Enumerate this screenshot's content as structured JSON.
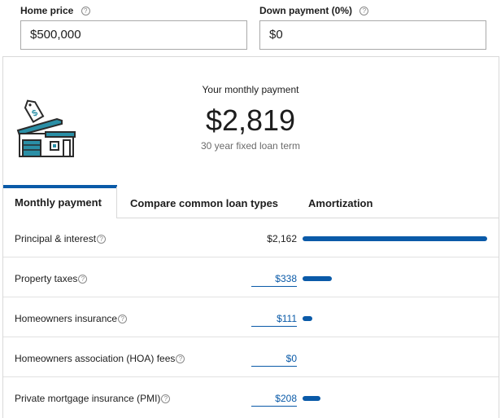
{
  "inputs": {
    "home_price": {
      "label": "Home price",
      "value": "$500,000"
    },
    "down_payment": {
      "label": "Down payment (0%)",
      "value": "$0"
    }
  },
  "help_glyph": "?",
  "summary": {
    "caption": "Your monthly payment",
    "amount": "$2,819",
    "term": "30 year fixed loan term"
  },
  "tabs": [
    {
      "label": "Monthly payment",
      "active": true
    },
    {
      "label": "Compare common loan types",
      "active": false
    },
    {
      "label": "Amortization",
      "active": false
    }
  ],
  "breakdown": [
    {
      "label": "Principal & interest",
      "amount": "$2,162",
      "editable": false,
      "fraction": 0.767
    },
    {
      "label": "Property taxes",
      "amount": "$338",
      "editable": true,
      "fraction": 0.12
    },
    {
      "label": "Homeowners insurance",
      "amount": "$111",
      "editable": true,
      "fraction": 0.039
    },
    {
      "label": "Homeowners association (HOA) fees",
      "amount": "$0",
      "editable": true,
      "fraction": 0
    },
    {
      "label": "Private mortgage insurance (PMI)",
      "amount": "$208",
      "editable": true,
      "fraction": 0.074
    }
  ],
  "colors": {
    "accent": "#0a5aa8",
    "icon_teal": "#2a8fa6",
    "icon_dark": "#2b2b2b"
  },
  "icons": [
    "house-price-tag-icon",
    "help-circle-icon"
  ]
}
